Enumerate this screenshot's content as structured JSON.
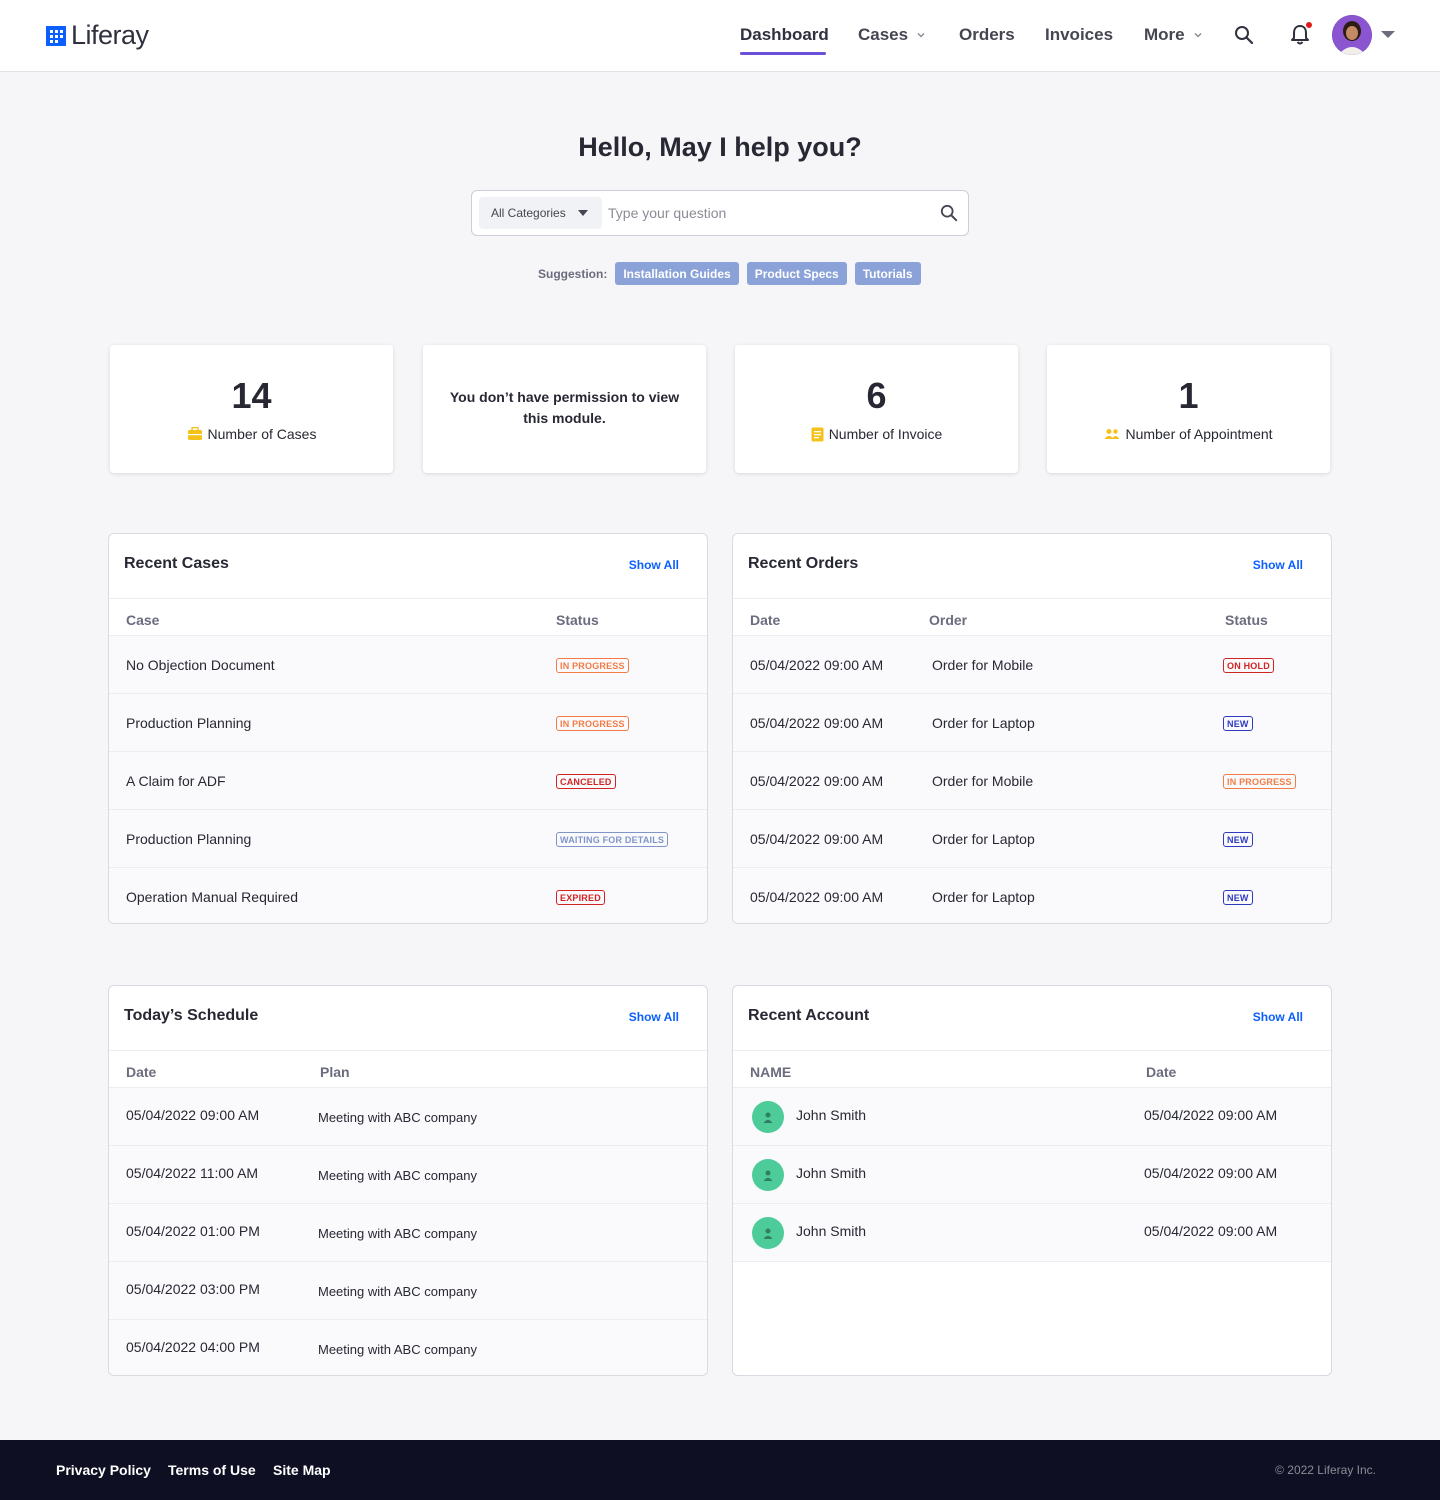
{
  "header": {
    "logo_text": "Liferay",
    "nav": {
      "dashboard": "Dashboard",
      "cases": "Cases",
      "orders": "Orders",
      "invoices": "Invoices",
      "more": "More"
    }
  },
  "hero": {
    "title": "Hello, May I help you?",
    "category": "All Categories",
    "search_placeholder": "Type your question",
    "suggestion_label": "Suggestion:",
    "suggestions": [
      "Installation Guides",
      "Product Specs",
      "Tutorials"
    ]
  },
  "stats": {
    "cases": {
      "value": "14",
      "label": "Number of Cases"
    },
    "permission_message": "You don’t have permission to view this module.",
    "invoice": {
      "value": "6",
      "label": "Number of Invoice"
    },
    "appointment": {
      "value": "1",
      "label": "Number of Appointment"
    }
  },
  "recent_cases": {
    "title": "Recent Cases",
    "show_all": "Show All",
    "columns": [
      "Case",
      "Status"
    ],
    "rows": [
      {
        "case": "No Objection Document",
        "status": "IN PROGRESS"
      },
      {
        "case": "Production Planning",
        "status": "IN PROGRESS"
      },
      {
        "case": "A Claim for ADF",
        "status": "CANCELED"
      },
      {
        "case": "Production Planning",
        "status": "WAITING FOR DETAILS"
      },
      {
        "case": "Operation Manual Required",
        "status": "EXPIRED"
      }
    ]
  },
  "recent_orders": {
    "title": "Recent Orders",
    "show_all": "Show All",
    "columns": [
      "Date",
      "Order",
      "Status"
    ],
    "rows": [
      {
        "date": "05/04/2022 09:00 AM",
        "order": "Order for Mobile",
        "status": "ON HOLD"
      },
      {
        "date": "05/04/2022 09:00 AM",
        "order": "Order for Laptop",
        "status": "NEW"
      },
      {
        "date": "05/04/2022 09:00 AM",
        "order": "Order for Mobile",
        "status": "IN PROGRESS"
      },
      {
        "date": "05/04/2022 09:00 AM",
        "order": "Order for Laptop",
        "status": "NEW"
      },
      {
        "date": "05/04/2022 09:00 AM",
        "order": "Order for Laptop",
        "status": "NEW"
      }
    ]
  },
  "todays_schedule": {
    "title": "Today’s Schedule",
    "show_all": "Show All",
    "columns": [
      "Date",
      "Plan"
    ],
    "rows": [
      {
        "date": "05/04/2022 09:00 AM",
        "plan": "Meeting with ABC company"
      },
      {
        "date": "05/04/2022 11:00 AM",
        "plan": "Meeting with ABC company"
      },
      {
        "date": "05/04/2022 01:00 PM",
        "plan": "Meeting with ABC company"
      },
      {
        "date": "05/04/2022 03:00 PM",
        "plan": "Meeting with ABC company"
      },
      {
        "date": "05/04/2022 04:00 PM",
        "plan": "Meeting with ABC company"
      }
    ]
  },
  "recent_account": {
    "title": "Recent Account",
    "show_all": "Show All",
    "columns": [
      "NAME",
      "Date"
    ],
    "rows": [
      {
        "name": "John Smith",
        "date": "05/04/2022 09:00 AM"
      },
      {
        "name": "John Smith",
        "date": "05/04/2022 09:00 AM"
      },
      {
        "name": "John Smith",
        "date": "05/04/2022 09:00 AM"
      }
    ]
  },
  "footer": {
    "links": [
      "Privacy Policy",
      "Terms of Use",
      "Site Map"
    ],
    "copyright": "© 2022 Liferay Inc."
  },
  "colors": {
    "accent": "#6b4fd6",
    "link": "#0b5fff",
    "chip": "#8aa2d8",
    "stat_icon": "#f5c21b",
    "account_avatar": "#4dcc9a",
    "footer_bg": "#0e0f22"
  },
  "icons": [
    "liferay-logo-icon",
    "chevron-down-icon",
    "search-icon",
    "bell-icon",
    "user-avatar",
    "caret-down-icon",
    "briefcase-icon",
    "invoice-icon",
    "people-icon",
    "user-icon"
  ]
}
